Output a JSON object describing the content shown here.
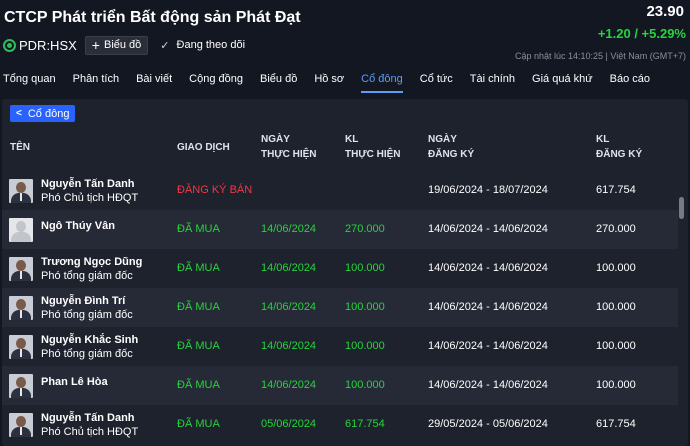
{
  "header": {
    "company": "CTCP Phát triển Bất động sản Phát Đạt",
    "ticker": "PDR:HSX",
    "chart_button": "Biểu đồ",
    "follow_label": "Đang theo dõi",
    "price": "23.90",
    "change": "+1.20 / +5.29%",
    "updated": "Cập nhật lúc  14:10:25 | Việt Nam (GMT+7)",
    "colors": {
      "up": "#26d43b",
      "down": "#f23645",
      "accent": "#2962ff"
    }
  },
  "nav": [
    "Tổng quan",
    "Phân tích",
    "Bài viết",
    "Cộng đồng",
    "Biểu đồ",
    "Hồ sơ",
    "Cổ đông",
    "Cổ tức",
    "Tài chính",
    "Giá quá khứ",
    "Báo cáo"
  ],
  "nav_active": "Cổ đông",
  "back_button": "Cổ đông",
  "table": {
    "headers": {
      "name": "TÊN",
      "transaction": "GIAO DỊCH",
      "exec_date_1": "NGÀY",
      "exec_date_2": "THỰC HIỆN",
      "exec_vol_1": "KL",
      "exec_vol_2": "THỰC HIỆN",
      "reg_date_1": "NGÀY",
      "reg_date_2": "ĐĂNG KÝ",
      "reg_vol_1": "KL",
      "reg_vol_2": "ĐĂNG KÝ"
    },
    "rows": [
      {
        "name": "Nguyễn Tấn Danh",
        "role": "Phó Chủ tịch HĐQT",
        "transaction": "ĐĂNG KÝ BÁN",
        "type": "register",
        "exec_date": "",
        "exec_volume": "",
        "reg_date": "19/06/2024 - 18/07/2024",
        "reg_volume": "617.754",
        "avatar": "photo"
      },
      {
        "name": "Ngô Thúy Vân",
        "role": "",
        "transaction": "ĐÃ MUA",
        "type": "buy",
        "exec_date": "14/06/2024",
        "exec_volume": "270.000",
        "reg_date": "14/06/2024 - 14/06/2024",
        "reg_volume": "270.000",
        "avatar": "blank"
      },
      {
        "name": "Trương Ngọc Dũng",
        "role": "Phó tổng giám đốc",
        "transaction": "ĐÃ MUA",
        "type": "buy",
        "exec_date": "14/06/2024",
        "exec_volume": "100.000",
        "reg_date": "14/06/2024 - 14/06/2024",
        "reg_volume": "100.000",
        "avatar": "photo"
      },
      {
        "name": "Nguyễn Đình Trí",
        "role": "Phó tổng giám đốc",
        "transaction": "ĐÃ MUA",
        "type": "buy",
        "exec_date": "14/06/2024",
        "exec_volume": "100.000",
        "reg_date": "14/06/2024 - 14/06/2024",
        "reg_volume": "100.000",
        "avatar": "photo"
      },
      {
        "name": "Nguyễn Khắc Sinh",
        "role": "Phó tổng giám đốc",
        "transaction": "ĐÃ MUA",
        "type": "buy",
        "exec_date": "14/06/2024",
        "exec_volume": "100.000",
        "reg_date": "14/06/2024 - 14/06/2024",
        "reg_volume": "100.000",
        "avatar": "photo"
      },
      {
        "name": "Phan Lê Hòa",
        "role": "",
        "transaction": "ĐÃ MUA",
        "type": "buy",
        "exec_date": "14/06/2024",
        "exec_volume": "100.000",
        "reg_date": "14/06/2024 - 14/06/2024",
        "reg_volume": "100.000",
        "avatar": "photo"
      },
      {
        "name": "Nguyễn Tấn Danh",
        "role": "Phó Chủ tịch HĐQT",
        "transaction": "ĐÃ MUA",
        "type": "buy",
        "exec_date": "05/06/2024",
        "exec_volume": "617.754",
        "reg_date": "29/05/2024 - 05/06/2024",
        "reg_volume": "617.754",
        "avatar": "photo"
      }
    ]
  }
}
